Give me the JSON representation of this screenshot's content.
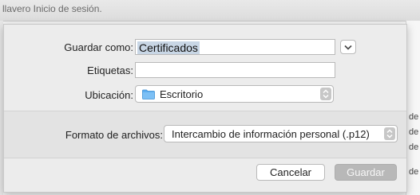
{
  "background_window": {
    "title_text": "llavero Inicio de sesión.",
    "right_snippets": [
      "de",
      "de",
      "de",
      "de"
    ]
  },
  "save_sheet": {
    "save_as_label": "Guardar como:",
    "save_as_value": "Certificados",
    "tags_label": "Etiquetas:",
    "tags_value": "",
    "location_label": "Ubicación:",
    "location_value": "Escritorio",
    "format_label": "Formato de archivos:",
    "format_value": "Intercambio de información personal (.p12)",
    "cancel_label": "Cancelar",
    "save_label": "Guardar"
  },
  "colors": {
    "selection": "#c8d6e5",
    "folder": "#5eaef0",
    "disabled_button": "#b8b8b8"
  },
  "icons": {
    "expand": "chevron-down-icon",
    "location": "folder-icon",
    "popup": "up-down-arrows-icon"
  }
}
